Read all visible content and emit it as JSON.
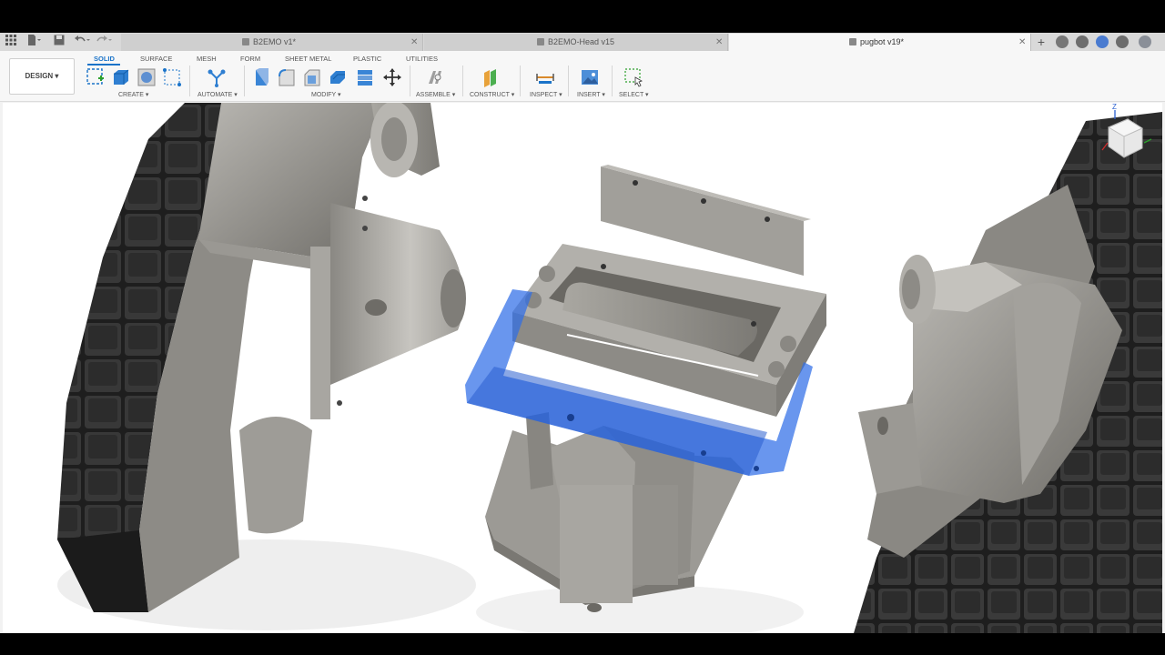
{
  "window": {
    "title": "pugbot v19*"
  },
  "tabs": [
    {
      "label": "B2EMO v1*",
      "active": false
    },
    {
      "label": "B2EMO-Head v15",
      "active": false
    },
    {
      "label": "pugbot v19*",
      "active": true
    }
  ],
  "workspace": {
    "label": "DESIGN"
  },
  "ribbon_tabs": [
    "SOLID",
    "SURFACE",
    "MESH",
    "FORM",
    "SHEET METAL",
    "PLASTIC",
    "UTILITIES"
  ],
  "groups": {
    "create": "CREATE",
    "automate": "AUTOMATE",
    "modify": "MODIFY",
    "assemble": "ASSEMBLE",
    "construct": "CONSTRUCT",
    "inspect": "INSPECT",
    "insert": "INSERT",
    "select": "SELECT"
  },
  "viewcube": {
    "axis_label": "Z"
  },
  "colors": {
    "accent": "#1a73c9",
    "selection": "#2f6ee8",
    "model_gray": "#8c8a85",
    "tread": "#2b2b2b"
  }
}
